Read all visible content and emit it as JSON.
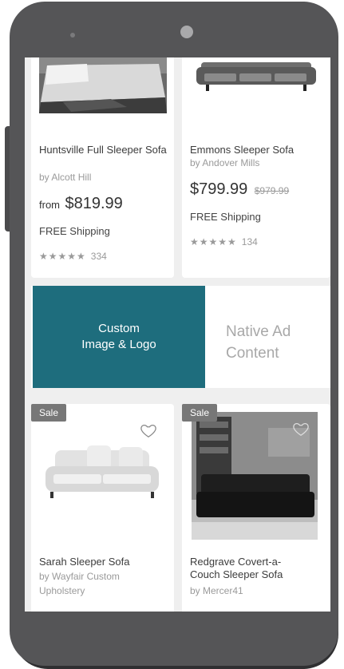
{
  "products_top": [
    {
      "title": "Huntsville Full Sleeper Sofa",
      "byline": "by Alcott Hill",
      "price_prefix": "from",
      "price": "$819.99",
      "shipping": "FREE Shipping",
      "stars": "★★★★★",
      "review_count": "334"
    },
    {
      "title": "Emmons Sleeper Sofa",
      "byline": "by Andover Mills",
      "price": "$799.99",
      "old_price": "$979.99",
      "shipping": "FREE Shipping",
      "stars": "★★★★★",
      "review_count": "134"
    }
  ],
  "ad": {
    "custom_line1": "Custom",
    "custom_line2": "Image & Logo",
    "native_line1": "Native Ad",
    "native_line2": "Content"
  },
  "products_bottom": [
    {
      "badge": "Sale",
      "title": "Sarah Sleeper Sofa",
      "byline_line1": "by Wayfair Custom",
      "byline_line2": "Upholstery"
    },
    {
      "badge": "Sale",
      "title_line1": "Redgrave Covert-a-",
      "title_line2": "Couch Sleeper Sofa",
      "byline": "by Mercer41"
    }
  ],
  "colors": {
    "ad_accent": "#1e6d7d",
    "sale_badge": "#777777",
    "frame": "#555557"
  },
  "icons": {
    "favorite": "heart-outline-icon",
    "rating": "star-icon"
  }
}
